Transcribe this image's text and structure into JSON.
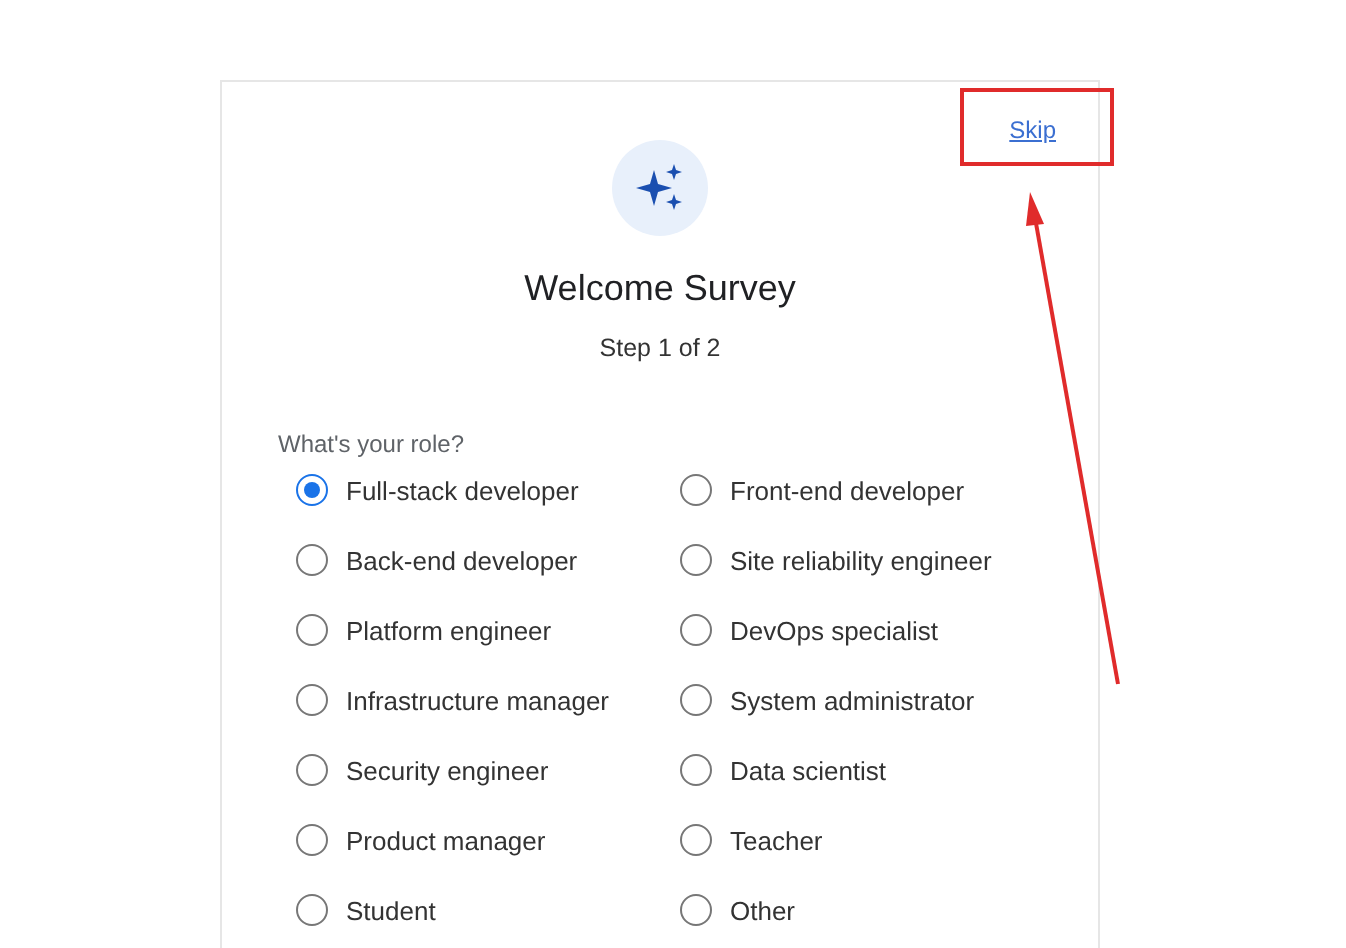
{
  "skip_link": "Skip",
  "title": "Welcome Survey",
  "step": "Step 1 of 2",
  "question": "What's your role?",
  "options": [
    {
      "label": "Full-stack developer",
      "selected": true
    },
    {
      "label": "Front-end developer",
      "selected": false
    },
    {
      "label": "Back-end developer",
      "selected": false
    },
    {
      "label": "Site reliability engineer",
      "selected": false
    },
    {
      "label": "Platform engineer",
      "selected": false
    },
    {
      "label": "DevOps specialist",
      "selected": false
    },
    {
      "label": "Infrastructure manager",
      "selected": false
    },
    {
      "label": "System administrator",
      "selected": false
    },
    {
      "label": "Security engineer",
      "selected": false
    },
    {
      "label": "Data scientist",
      "selected": false
    },
    {
      "label": "Product manager",
      "selected": false
    },
    {
      "label": "Teacher",
      "selected": false
    },
    {
      "label": "Student",
      "selected": false
    },
    {
      "label": "Other",
      "selected": false
    }
  ]
}
